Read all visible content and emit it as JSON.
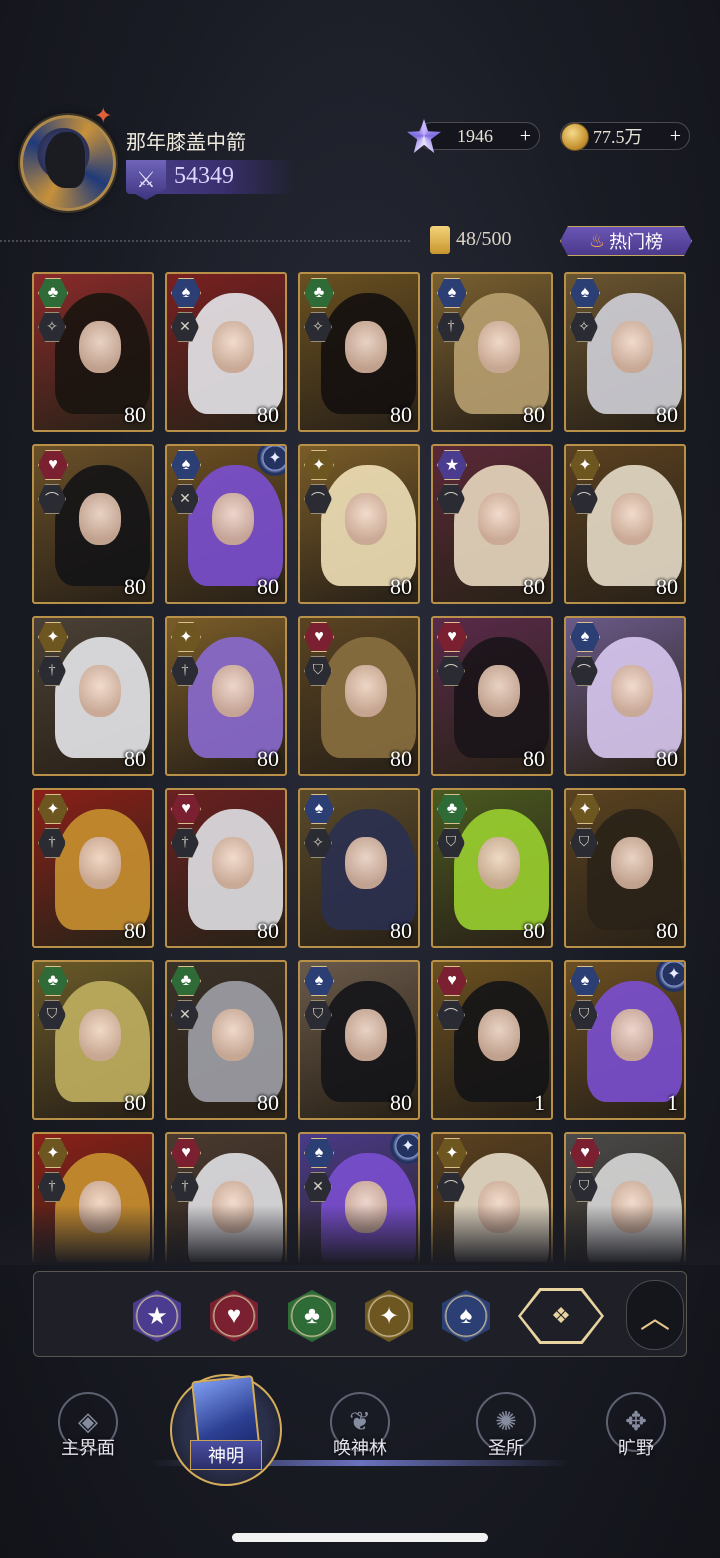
{
  "header": {
    "player_name": "那年膝盖中箭",
    "power": "54349",
    "gems": "1946",
    "coins": "77.5万",
    "plus_symbol": "+"
  },
  "collection": {
    "count": "48/500",
    "hot_label": "热门榜"
  },
  "cards": [
    {
      "suit": "club",
      "cls": "✧",
      "level": "80",
      "tone": "#8a2a2a",
      "hair": "#1a1410"
    },
    {
      "suit": "spade",
      "cls": "✕",
      "level": "80",
      "tone": "#7a2020",
      "hair": "#e6e6ea"
    },
    {
      "suit": "club",
      "cls": "✧",
      "level": "80",
      "tone": "#6a5020",
      "hair": "#141010"
    },
    {
      "suit": "spade",
      "cls": "†",
      "level": "80",
      "tone": "#7a6030",
      "hair": "#b8a070"
    },
    {
      "suit": "spade",
      "cls": "✧",
      "level": "80",
      "tone": "#6a5530",
      "hair": "#d0d0d8"
    },
    {
      "suit": "heart",
      "cls": "⌒",
      "level": "80",
      "tone": "#6a5028",
      "hair": "#141416"
    },
    {
      "suit": "spade",
      "cls": "✕",
      "level": "80",
      "tone": "#6b4e22",
      "hair": "#7a4fd0",
      "star": true
    },
    {
      "suit": "diamond",
      "cls": "⌒",
      "level": "80",
      "tone": "#7a5c28",
      "hair": "#efe0b8"
    },
    {
      "suit": "star",
      "cls": "⌒",
      "level": "80",
      "tone": "#5a2838",
      "hair": "#e8d8c0"
    },
    {
      "suit": "diamond",
      "cls": "⌒",
      "level": "80",
      "tone": "#5a4020",
      "hair": "#e6dcc8"
    },
    {
      "suit": "diamond",
      "cls": "†",
      "level": "80",
      "tone": "#4a4036",
      "hair": "#e6e6ea"
    },
    {
      "suit": "diamond",
      "cls": "†",
      "level": "80",
      "tone": "#7a5c28",
      "hair": "#8a6ad0"
    },
    {
      "suit": "heart",
      "cls": "⛉",
      "level": "80",
      "tone": "#5a4422",
      "hair": "#8a7040"
    },
    {
      "suit": "heart",
      "cls": "⌒",
      "level": "80",
      "tone": "#5a2a4a",
      "hair": "#1a1418"
    },
    {
      "suit": "spade",
      "cls": "⌒",
      "level": "80",
      "tone": "#6a5a8a",
      "hair": "#d8c8ef"
    },
    {
      "suit": "diamond",
      "cls": "†",
      "level": "80",
      "tone": "#8a2018",
      "hair": "#c89030"
    },
    {
      "suit": "heart",
      "cls": "†",
      "level": "80",
      "tone": "#6a2020",
      "hair": "#e0e0e4"
    },
    {
      "suit": "spade",
      "cls": "✧",
      "level": "80",
      "tone": "#5a4a2a",
      "hair": "#2a3050"
    },
    {
      "suit": "club",
      "cls": "⛉",
      "level": "80",
      "tone": "#4a5a20",
      "hair": "#9ad030"
    },
    {
      "suit": "diamond",
      "cls": "⛉",
      "level": "80",
      "tone": "#5a4220",
      "hair": "#2a2218"
    },
    {
      "suit": "club",
      "cls": "⛉",
      "level": "80",
      "tone": "#6a5a28",
      "hair": "#c0b060"
    },
    {
      "suit": "club",
      "cls": "✕",
      "level": "80",
      "tone": "#3a3228",
      "hair": "#a0a0a8"
    },
    {
      "suit": "spade",
      "cls": "⛉",
      "level": "80",
      "tone": "#6a5a4a",
      "hair": "#141418"
    },
    {
      "suit": "heart",
      "cls": "⌒",
      "level": "1",
      "tone": "#6a5020",
      "hair": "#141416"
    },
    {
      "suit": "spade",
      "cls": "⛉",
      "level": "1",
      "tone": "#6b4e22",
      "hair": "#7a4fd0",
      "star": true
    },
    {
      "suit": "diamond",
      "cls": "†",
      "level": "",
      "tone": "#8a2018",
      "hair": "#c89030"
    },
    {
      "suit": "heart",
      "cls": "†",
      "level": "",
      "tone": "#4a3a30",
      "hair": "#e0e0e4"
    },
    {
      "suit": "spade",
      "cls": "✕",
      "level": "",
      "tone": "#4a3a8a",
      "hair": "#7a4fd0",
      "star": true
    },
    {
      "suit": "diamond",
      "cls": "⌒",
      "level": "",
      "tone": "#5a4020",
      "hair": "#e6dcc8"
    },
    {
      "suit": "heart",
      "cls": "⛉",
      "level": "",
      "tone": "#4a4a4a",
      "hair": "#d8d8d8"
    }
  ],
  "filters": [
    {
      "name": "star",
      "glyph": "★",
      "color": "#4c3c8f"
    },
    {
      "name": "heart",
      "glyph": "♥",
      "color": "#7a2030"
    },
    {
      "name": "club",
      "glyph": "♣",
      "color": "#2f6b36"
    },
    {
      "name": "diamond",
      "glyph": "✦",
      "color": "#6e5620"
    },
    {
      "name": "spade",
      "glyph": "♠",
      "color": "#2c3f75"
    }
  ],
  "filter_all_glyph": "❖",
  "nav": [
    {
      "label": "主界面",
      "icon": "world-emblem-icon"
    },
    {
      "label": "神明",
      "icon": "gods-card-icon"
    },
    {
      "label": "唤神林",
      "icon": "tree-emblem-icon"
    },
    {
      "label": "圣所",
      "icon": "sanctuary-emblem-icon"
    },
    {
      "label": "旷野",
      "icon": "compass-emblem-icon"
    }
  ]
}
